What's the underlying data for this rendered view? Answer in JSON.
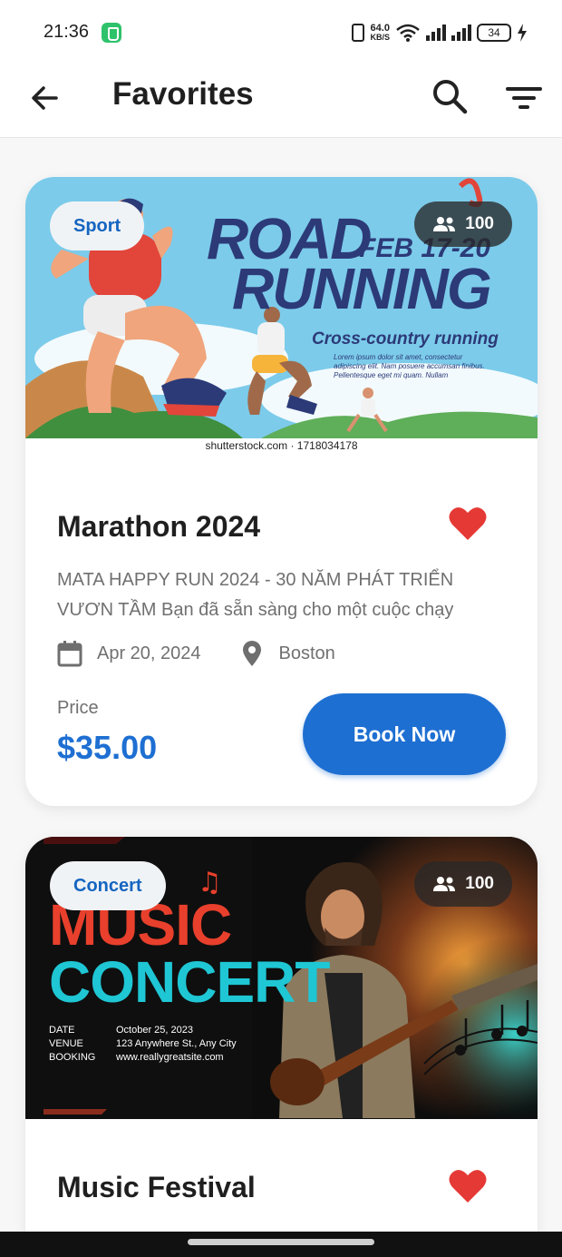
{
  "status_bar": {
    "time": "21:36",
    "net_speed_value": "64.0",
    "net_speed_unit": "KB/S",
    "battery": "34",
    "icons": [
      "shield-app-icon",
      "vibrate-icon",
      "wifi-icon",
      "signal-icon",
      "battery-icon",
      "charging-icon"
    ]
  },
  "appbar": {
    "title": "Favorites",
    "icons": [
      "back-arrow-icon",
      "search-icon",
      "filter-icon"
    ]
  },
  "events": [
    {
      "category": "Sport",
      "attendees": "100",
      "title": "Marathon 2024",
      "description_line1": "MATA HAPPY RUN 2024 - 30 NĂM PHÁT TRIỂN",
      "description_line2": "VƯƠN TẦM  Bạn đã sẵn sàng cho một cuộc chạy",
      "date": "Apr 20, 2024",
      "location": "Boston",
      "price_label": "Price",
      "price": "$35.00",
      "button_label": "Book Now",
      "poster": {
        "line1": "ROAD",
        "date_text": "FEB 17-20",
        "line2": "RUNNING",
        "subtitle": "Cross-country running",
        "body": "Lorem ipsum dolor sit amet, consectetur adipiscing elit. Nam posuere accumsan finibus. Pellentesque eget mi quam. Nullam",
        "credit": "shutterstock.com · 1718034178"
      },
      "favorited": true,
      "heart_color": "#e53935"
    },
    {
      "category": "Concert",
      "attendees": "100",
      "title": "Music Festival",
      "poster": {
        "line1": "MUSIC",
        "line2": "CONCERT",
        "info": [
          {
            "label": "DATE",
            "value": "October 25, 2023"
          },
          {
            "label": "VENUE",
            "value": "123 Anywhere St., Any City"
          },
          {
            "label": "BOOKING",
            "value": "www.reallygreatsite.com"
          }
        ]
      },
      "favorited": true,
      "heart_color": "#e53935"
    }
  ],
  "colors": {
    "accent": "#1e6fd2",
    "chip_text": "#1565c0",
    "heart": "#e53935"
  }
}
